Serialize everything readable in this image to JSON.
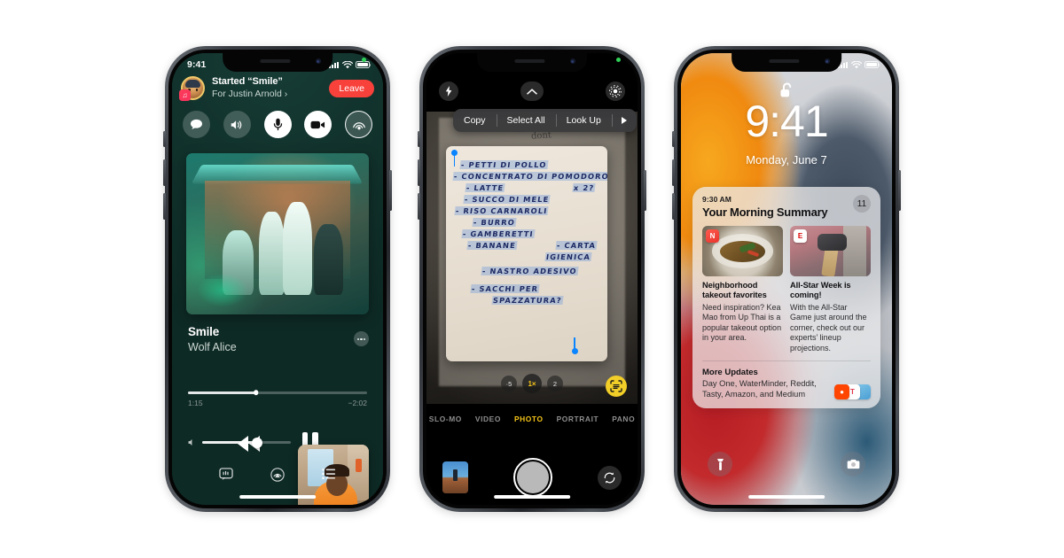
{
  "phone1": {
    "name": "iphone-music-shareplay",
    "status_bar": {
      "time": "9:41"
    },
    "shareplay": {
      "title": "Started “Smile”",
      "subtitle": "For Justin Arnold ›",
      "leave_label": "Leave",
      "controls": [
        "message-icon",
        "speaker-icon",
        "microphone-icon",
        "video-camera-icon",
        "shareplay-icon"
      ]
    },
    "now_playing": {
      "track": "Smile",
      "artist": "Wolf Alice",
      "elapsed": "1:15",
      "remaining": "−2:02",
      "progress_pct": 38,
      "volume_pct": 62,
      "more_icon": "ellipsis-icon",
      "transport": [
        "rewind-icon",
        "pause-icon"
      ],
      "toolbar": [
        "lyrics-icon",
        "airplay-icon",
        "queue-icon"
      ]
    }
  },
  "phone2": {
    "name": "iphone-camera-live-text",
    "top_controls": [
      "flash-icon",
      "chevron-up-icon",
      "live-photo-icon"
    ],
    "context_menu": {
      "items": [
        "Copy",
        "Select All",
        "Look Up"
      ],
      "more_icon": "triangle-right-icon"
    },
    "note_lines": [
      "- PETTI DI POLLO",
      "- CONCENTRATO DI POMODORO",
      "- LATTE",
      "x 2?",
      "- SUCCO DI MELE",
      "- RISO CARNAROLI",
      "- BURRO",
      "- GAMBERETTI",
      "- BANANE",
      "- CARTA",
      "IGIENICA",
      "- NASTRO ADESIVO",
      "- SACCHI PER",
      "SPAZZATURA?"
    ],
    "zoom_levels": [
      "·5",
      "1×",
      "2"
    ],
    "zoom_active": "1×",
    "live_text_icon": "live-text-scan-icon",
    "modes": [
      "SLO-MO",
      "VIDEO",
      "PHOTO",
      "PORTRAIT",
      "PANO"
    ],
    "active_mode": "PHOTO",
    "bottom": {
      "thumbnail": "last-photo-thumbnail",
      "shutter": "shutter-button",
      "flip": "flip-camera-icon"
    }
  },
  "phone3": {
    "name": "iphone-lock-screen-notification-summary",
    "lock_icon": "unlocked-padlock-icon",
    "time": "9:41",
    "date": "Monday, June 7",
    "summary": {
      "time": "9:30 AM",
      "title": "Your Morning Summary",
      "badge": "11",
      "stories": [
        {
          "app_icon": "news-app-icon",
          "image": "thai-noodle-dish-photo",
          "headline": "Neighborhood takeout favorites",
          "body": "Need inspiration? Kea Mao from Up Thai is a popular takeout option in your area."
        },
        {
          "app_icon": "espn-app-icon",
          "image": "baseball-bat-glove-photo",
          "headline": "All-Star Week is coming!",
          "body": "With the All-Star Game just around the corner, check out our experts’ lineup projections."
        }
      ],
      "more": {
        "heading": "More Updates",
        "body": "Day One, WaterMinder, Reddit, Tasty, Amazon, and Medium",
        "icons": [
          "reddit-icon",
          "tasty-icon",
          "medium-icon"
        ]
      }
    },
    "bottom_controls": [
      "flashlight-icon",
      "camera-icon"
    ]
  }
}
